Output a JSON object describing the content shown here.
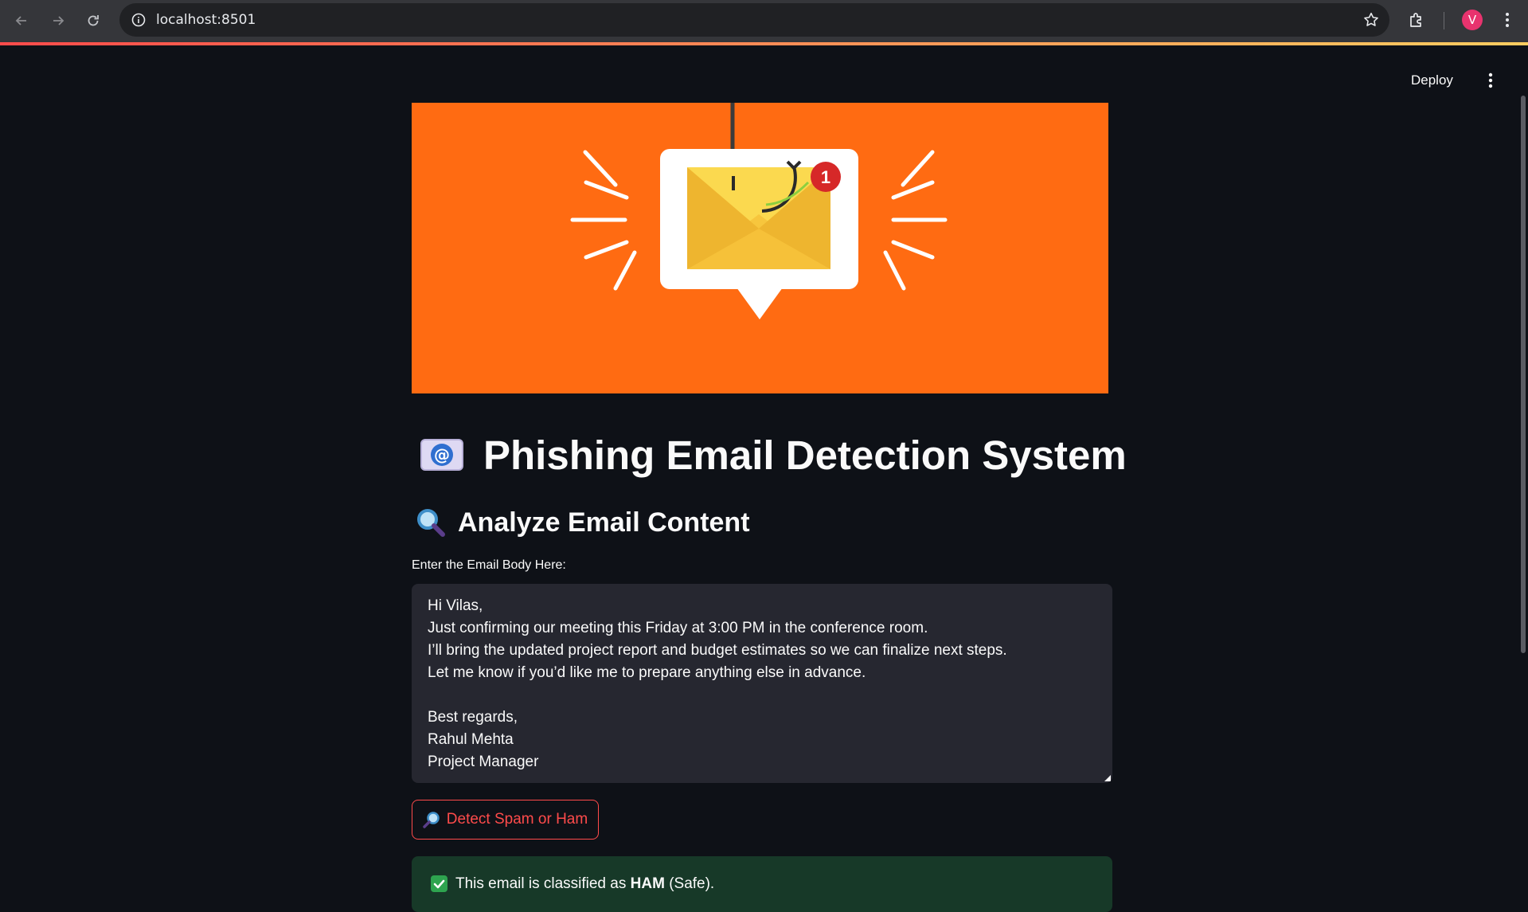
{
  "browser": {
    "url": "localhost:8501",
    "profile_initial": "V",
    "accent_color": "#ff4b4b"
  },
  "header": {
    "deploy_label": "Deploy"
  },
  "banner": {
    "notification_count": "1",
    "background_color": "#ff6b12"
  },
  "main": {
    "title_icon": "email-at-icon",
    "title": "Phishing Email Detection System",
    "subtitle_icon": "magnifying-glass-icon",
    "subtitle": "Analyze Email Content",
    "input_label": "Enter the Email Body Here:",
    "email_body": "Hi Vilas,\nJust confirming our meeting this Friday at 3:00 PM in the conference room.\nI’ll bring the updated project report and budget estimates so we can finalize next steps.\nLet me know if you’d like me to prepare anything else in advance.\n\nBest regards,\nRahul Mehta\nProject Manager",
    "detect_button_icon": "magnifying-glass-right-icon",
    "detect_button_label": "Detect Spam or Ham",
    "result": {
      "icon": "check-mark-icon",
      "prefix": "This email is classified as",
      "verdict": "HAM",
      "suffix": "(Safe).",
      "status_color": "#173928"
    }
  }
}
